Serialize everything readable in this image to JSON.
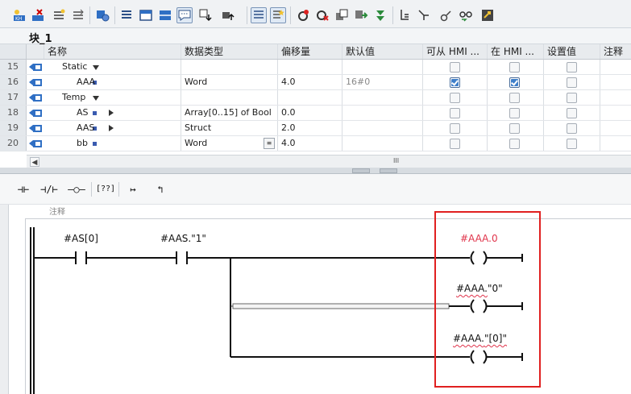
{
  "toolbar": {
    "icons": [
      "insert-row-icon",
      "delete-row-icon",
      "add-row-icon",
      "add-block-icon",
      "monitor-icon",
      "list-icon",
      "window-icon",
      "split-icon",
      "comment-icon",
      "download-icon",
      "upload-icon",
      "view-icon",
      "favorites-icon",
      "breakpoint-icon",
      "breakpoint-remove-icon",
      "copy-icon",
      "transfer-icon",
      "compare-icon",
      "sort-icon",
      "expand-icon",
      "connect-icon",
      "glasses-icon",
      "monitor-all-icon"
    ]
  },
  "block": {
    "title": "块_1"
  },
  "table": {
    "headers": {
      "name": "名称",
      "datatype": "数据类型",
      "offset": "偏移量",
      "default": "默认值",
      "hmi_access": "可从 HMI ...",
      "hmi_visible": "在 HMI ...",
      "setpoint": "设置值",
      "comment": "注释"
    },
    "rows": [
      {
        "num": "15",
        "name": "Static",
        "datatype": "",
        "offset": "",
        "default": "",
        "hmi_access": false,
        "hmi_visible": false,
        "setpoint": false,
        "kind": "section"
      },
      {
        "num": "16",
        "name": "AAA",
        "datatype": "Word",
        "offset": "4.0",
        "default": "16#0",
        "hmi_access": true,
        "hmi_visible": true,
        "setpoint": false,
        "kind": "item"
      },
      {
        "num": "17",
        "name": "Temp",
        "datatype": "",
        "offset": "",
        "default": "",
        "hmi_access": false,
        "hmi_visible": false,
        "setpoint": false,
        "kind": "section"
      },
      {
        "num": "18",
        "name": "AS",
        "datatype": "Array[0..15] of Bool",
        "offset": "0.0",
        "default": "",
        "hmi_access": false,
        "hmi_visible": false,
        "setpoint": false,
        "kind": "struct"
      },
      {
        "num": "19",
        "name": "AAS",
        "datatype": "Struct",
        "offset": "2.0",
        "default": "",
        "hmi_access": false,
        "hmi_visible": false,
        "setpoint": false,
        "kind": "struct"
      },
      {
        "num": "20",
        "name": "bb",
        "datatype": "Word",
        "offset": "4.0",
        "default": "",
        "hmi_access": false,
        "hmi_visible": false,
        "setpoint": false,
        "kind": "item"
      }
    ],
    "scroll_grip": "III"
  },
  "lad_toolbar": {
    "buttons": [
      {
        "name": "no-contact-button",
        "label": "⊣⊢"
      },
      {
        "name": "nc-contact-button",
        "label": "⊣/⊢"
      },
      {
        "name": "coil-button",
        "label": "–○–"
      },
      {
        "name": "empty-box-button",
        "label": "[??]"
      },
      {
        "name": "open-branch-button",
        "label": "↦"
      },
      {
        "name": "close-branch-button",
        "label": "↰"
      }
    ]
  },
  "network": {
    "label": "注释",
    "contact1": "#AS[0]",
    "contact2": "#AAS.\"1\"",
    "coil1": "#AAA.0",
    "coil2_prefix": "#AAA.",
    "coil2_suffix": "\"0\"",
    "coil3_prefix": "#AAA.",
    "coil3_suffix": "\"[0]\""
  },
  "colors": {
    "error_text": "#e0344b",
    "highlight": "#e02020",
    "checkbox_on": "#3f7fc9"
  }
}
